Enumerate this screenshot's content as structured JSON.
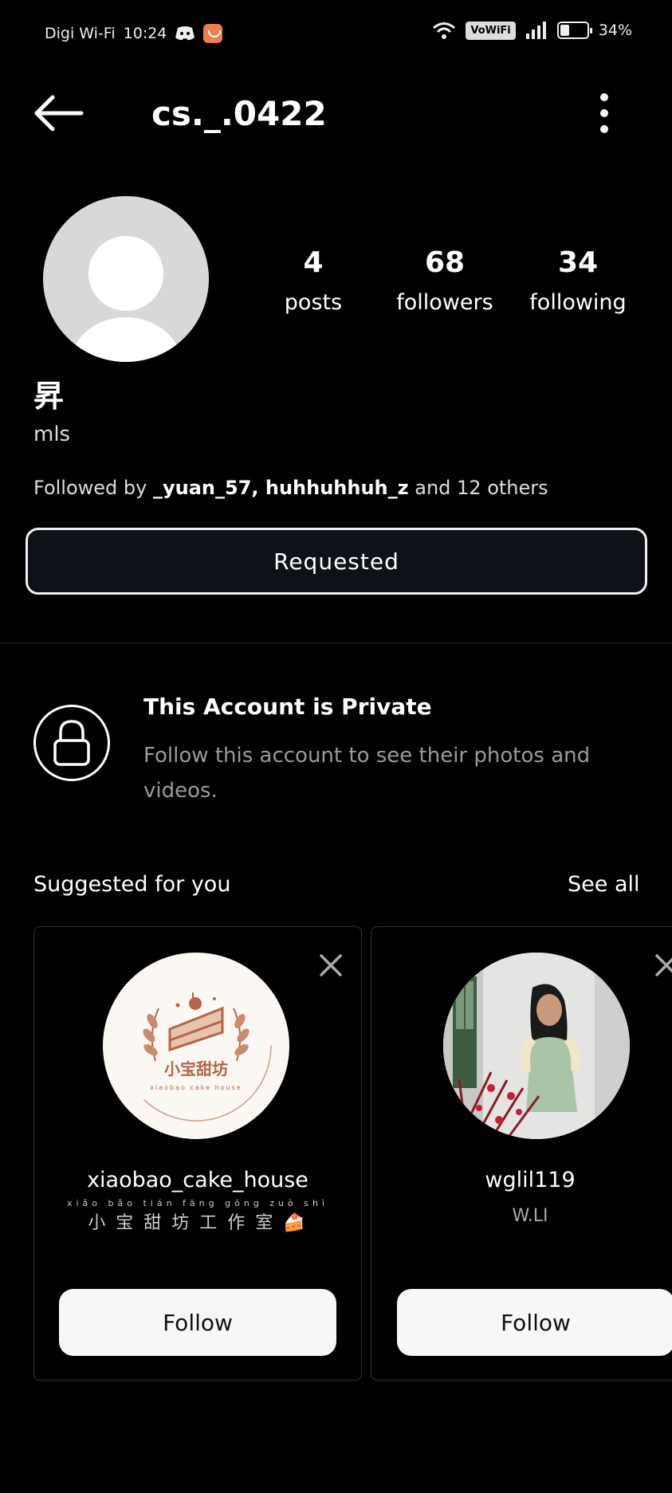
{
  "status_bar": {
    "carrier": "Digi Wi-Fi",
    "time": "10:24",
    "vowifi": "VoWiFi",
    "battery": "34%",
    "battery_level": 0.34
  },
  "header": {
    "username": "cs._.0422"
  },
  "profile": {
    "stats": [
      {
        "value": "4",
        "label": "posts"
      },
      {
        "value": "68",
        "label": "followers"
      },
      {
        "value": "34",
        "label": "following"
      }
    ],
    "name": "昇",
    "bio": "mls",
    "followed_by_prefix": "Followed by ",
    "followed_by_users": "_yuan_57, huhhuhhuh_z",
    "followed_by_suffix": " and 12 others",
    "requested_label": "Requested"
  },
  "private_notice": {
    "title": "This Account is Private",
    "text": "Follow this account to see their photos and videos."
  },
  "suggested": {
    "title": "Suggested for you",
    "see_all": "See all",
    "cards": [
      {
        "username": "xiaobao_cake_house",
        "subtitle": "小 宝 甜 坊 工 作 室 🍰",
        "pinyin": "xiǎo bǎo tián fāng gōng zuò shì",
        "logo_text": "小宝甜坊",
        "logo_subtext": "xiaobao cake house",
        "follow_label": "Follow"
      },
      {
        "username": "wglil119",
        "subtitle": "W.LI",
        "follow_label": "Follow"
      }
    ]
  },
  "colors": {
    "background": "#000000",
    "button_dark": "#0e1117",
    "follow_button": "#f7f7f7",
    "muted_text": "#9a9a9a",
    "logo_brown": "#b5644a"
  }
}
